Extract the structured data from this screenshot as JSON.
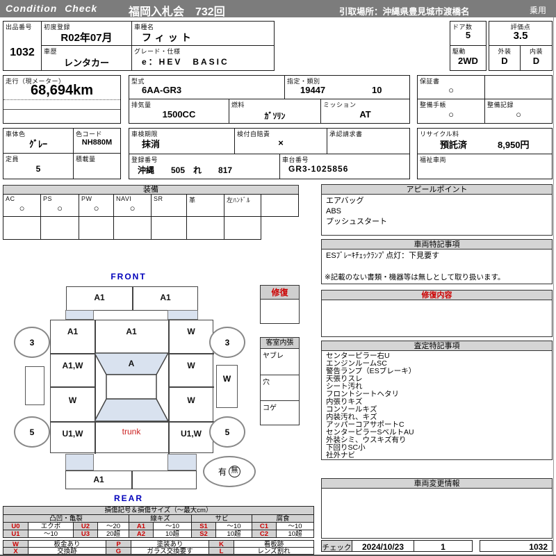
{
  "colors": {
    "header_gray": "#7c7c7c",
    "section_gray": "#d5d5d5",
    "glass_blue": "#d9e2ef",
    "accent_red": "#cc0000",
    "label_blue": "#0000bb"
  },
  "header": {
    "brand": "Condition  Check",
    "title": "福岡入札会　732回",
    "pickup": "引取場所：沖縄県豊見城市渡橋名",
    "category": "乗用"
  },
  "overview": {
    "lot_label": "出品番号",
    "lot_no": "1032",
    "first_reg_label": "初度登録",
    "first_reg": "R02年07月",
    "history_label": "車歴",
    "history": "レンタカー",
    "model_label": "車種名",
    "model": "フィット",
    "grade_label": "グレード・仕様",
    "grade": "e：HEV　BASIC",
    "doors_label": "ドア数",
    "doors": "5",
    "drive_label": "駆動",
    "drive": "2WD",
    "score_label": "評価点",
    "score": "3.5",
    "exterior_label": "外装",
    "exterior": "D",
    "interior_label": "内装",
    "interior": "D"
  },
  "engine": {
    "mileage_label": "走行（現メーター）",
    "mileage": "68,694km",
    "model_code_label": "型式",
    "model_code": "6AA-GR3",
    "class_label": "指定・類別",
    "class_no": "19447",
    "class_sub": "10",
    "displacement_label": "排気量",
    "displacement": "1500CC",
    "fuel_label": "燃料",
    "fuel": "ｶﾞｿﾘﾝ",
    "transmission_label": "ミッション",
    "transmission": "AT",
    "warranty_label": "保証書",
    "warranty": "○",
    "service_book_label": "整備手帳",
    "service_book": "○",
    "service_record_label": "整備記録",
    "service_record": "○"
  },
  "registration": {
    "body_color_label": "車体色",
    "body_color": "ｸﾞﾚｰ",
    "color_code_label": "色コード",
    "color_code": "NH880M",
    "seats_label": "定員",
    "seats": "5",
    "payload_label": "積載量",
    "payload": "",
    "inspection_label": "車検期限",
    "inspection": "抹消",
    "insurance_label": "検付自賠責",
    "insurance": "×",
    "approval_label": "承認請求書",
    "approval": "",
    "plate_label": "登録番号",
    "plate": "沖縄　　505　れ　　817",
    "chassis_label": "車台番号",
    "chassis": "GR3-1025856",
    "recycle_label": "リサイクル料",
    "recycle_status": "預託済",
    "recycle_fee": "8,950円",
    "welfare_label": "福祉車両",
    "welfare": ""
  },
  "equipment": {
    "title": "装備",
    "cols": [
      {
        "label": "AC",
        "mark": "○"
      },
      {
        "label": "PS",
        "mark": "○"
      },
      {
        "label": "PW",
        "mark": "○"
      },
      {
        "label": "NAVI",
        "mark": "○"
      },
      {
        "label": "SR",
        "mark": ""
      },
      {
        "label": "革",
        "mark": ""
      },
      {
        "label": "左ﾊﾝﾄﾞﾙ",
        "mark": ""
      },
      {
        "label": "",
        "mark": ""
      }
    ]
  },
  "appeal": {
    "title": "アピールポイント",
    "lines": [
      "エアバッグ",
      "ABS",
      "プッシュスタート"
    ]
  },
  "special_notes": {
    "title": "車両特記事項",
    "line": "ESﾌﾞﾚｰｷﾁｪｯｸﾗﾝﾌﾟ点灯：下見要す",
    "disclaimer": "※記載のない書類・機器等は無しとして取り扱います。"
  },
  "repair_detail": {
    "title": "修復内容"
  },
  "assessment": {
    "title": "査定特記事項",
    "lines": [
      "センターピラー右U",
      "エンジンルームSC",
      "警告ランプ（ESブレーキ）",
      "天張りスレ",
      "シート汚れ",
      "フロントシートヘタリ",
      "内張りキズ",
      "コンソールキズ",
      "内装汚れ、キズ",
      "アッパーコアサポートC",
      "センターピラーSベルトAU",
      "外装シミ、ウスキズ有り",
      "下回りSC小",
      "社外ナビ"
    ]
  },
  "change_info": {
    "title": "車両変更情報"
  },
  "check": {
    "label": "チェック",
    "date": "2024/10/23",
    "count": "1",
    "lot_no": "1032"
  },
  "diagram": {
    "front": "FRONT",
    "rear": "REAR",
    "repair_box": "修復",
    "cabin_legend": {
      "title": "客室内張",
      "rows": [
        "ヤブレ",
        "穴",
        "コゲ"
      ]
    },
    "spare": {
      "has": "有",
      "none": "無"
    },
    "tires": {
      "fl": "3",
      "fr": "3",
      "rl": "5",
      "rr": "5"
    },
    "panels": {
      "front_bumper_l": "A1",
      "front_bumper_r": "A1",
      "fender_fl": "A1",
      "hood": "A1",
      "fender_fr": "W",
      "door_fl": "A1,W",
      "windshield": "A",
      "door_fr": "W",
      "door_rl": "W",
      "door_rr": "W",
      "rocker_r": "W",
      "quarter_l": "U1,W",
      "trunk": "trunk",
      "quarter_r": "U1,W",
      "rear_bumper_l": "A1",
      "rear_bumper_r": ""
    }
  },
  "legend": {
    "title": "損傷記号＆損傷サイズ（〜最大cm）",
    "groups": [
      "凸凹・亀裂",
      "線キズ",
      "サビ",
      "腐食"
    ],
    "rows": [
      [
        [
          "U0",
          "エクボ"
        ],
        [
          "U2",
          "〜20"
        ],
        [
          "A1",
          "〜10"
        ],
        [
          "S1",
          "〜10"
        ],
        [
          "C1",
          "〜10"
        ]
      ],
      [
        [
          "U1",
          "〜10"
        ],
        [
          "U3",
          "20超"
        ],
        [
          "A2",
          "10超"
        ],
        [
          "S2",
          "10超"
        ],
        [
          "C2",
          "10超"
        ]
      ]
    ],
    "marks": [
      [
        [
          "W",
          "板金あり"
        ],
        [
          "P",
          "塗装あり"
        ],
        [
          "K",
          "看板跡"
        ]
      ],
      [
        [
          "X",
          "交換跡"
        ],
        [
          "G",
          "ガラス交換要す"
        ],
        [
          "L",
          "レンズ割れ"
        ]
      ]
    ]
  }
}
